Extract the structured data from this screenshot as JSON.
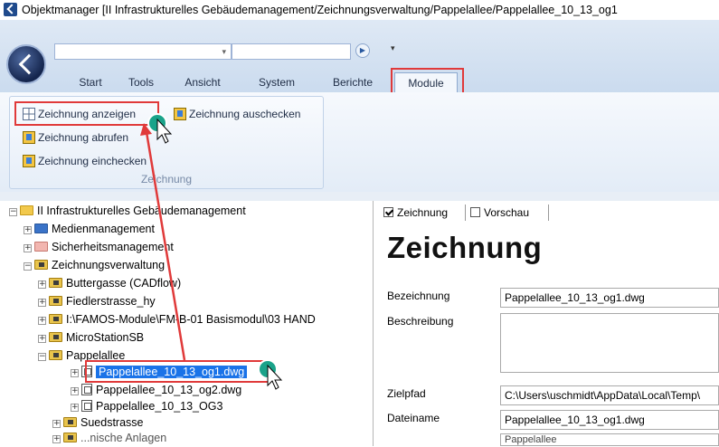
{
  "window": {
    "title": "Objektmanager [II  Infrastrukturelles Gebäudemanagement/Zeichnungsverwaltung/Pappelallee/Pappelallee_10_13_og1"
  },
  "toolbar": {
    "forward_glyph": "▶",
    "qat_glyph": "▾",
    "combo_arrow": "▾"
  },
  "ribbon": {
    "tabs": [
      {
        "label": "Start"
      },
      {
        "label": "Tools"
      },
      {
        "label": "Ansicht"
      },
      {
        "label": "System"
      },
      {
        "label": "Berichte"
      },
      {
        "label": "Module",
        "active": true
      }
    ],
    "group": {
      "label": "Zeichnung",
      "buttons": {
        "anzeigen": "Zeichnung anzeigen",
        "auschecken": "Zeichnung auschecken",
        "abrufen": "Zeichnung abrufen",
        "einchecken": "Zeichnung einchecken"
      }
    }
  },
  "tree": {
    "root": "II  Infrastrukturelles Gebäudemanagement",
    "items": [
      "Medienmanagement",
      "Sicherheitsmanagement",
      "Zeichnungsverwaltung",
      "Buttergasse (CADflow)",
      "Fiedlerstrasse_hy",
      "I:\\FAMOS-Module\\FM-B-01 Basismodul\\03 HAND",
      "MicroStationSB",
      "Pappelallee",
      "Pappelallee_10_13_og1.dwg",
      "Pappelallee_10_13_og2.dwg",
      "Pappelallee_10_13_OG3",
      "Suedstrasse",
      "...nische Anlagen"
    ]
  },
  "detail": {
    "tabs": {
      "zeichnung": "Zeichnung",
      "vorschau": "Vorschau"
    },
    "heading": "Zeichnung",
    "fields": {
      "bezeichnung_label": "Bezeichnung",
      "bezeichnung_value": "Pappelallee_10_13_og1.dwg",
      "beschreibung_label": "Beschreibung",
      "beschreibung_value": "",
      "zielpfad_label": "Zielpfad",
      "zielpfad_value": "C:\\Users\\uschmidt\\AppData\\Local\\Temp\\",
      "dateiname_label": "Dateiname",
      "dateiname_value": "Pappelallee_10_13_og1.dwg",
      "partial_value": "Pappelallee"
    }
  },
  "colors": {
    "highlight": "#e03a3a",
    "selection": "#1a73e8",
    "marker": "#1aa38a"
  }
}
